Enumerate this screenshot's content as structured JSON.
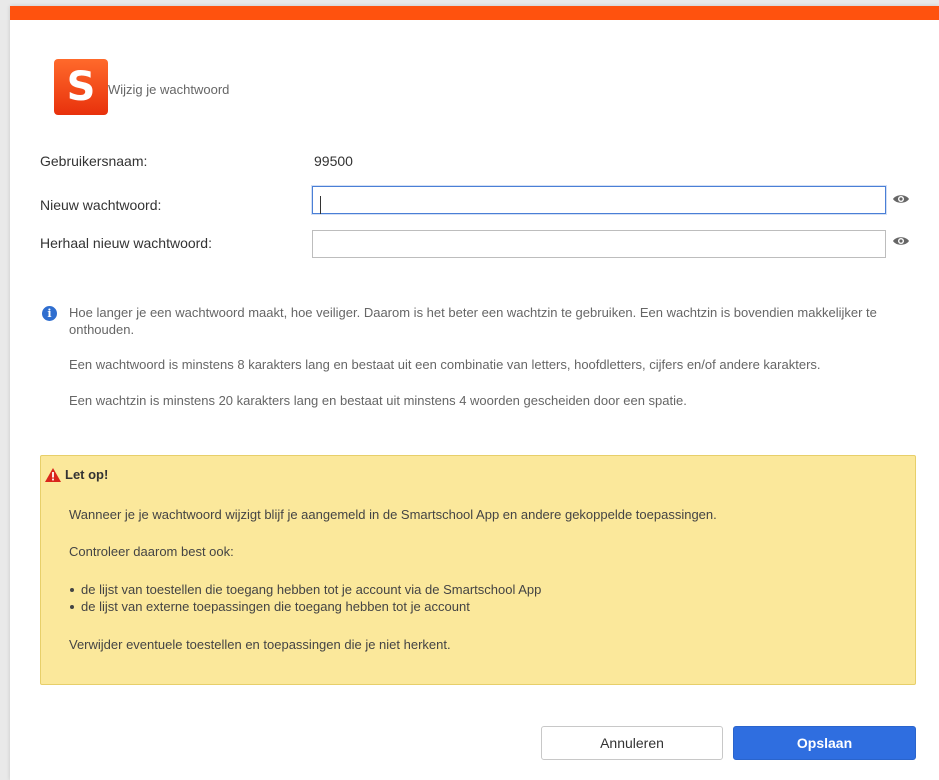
{
  "dialog": {
    "logo_letter": "S",
    "title": "Wijzig je wachtwoord",
    "accent_color": "#ff520e"
  },
  "form": {
    "username_label": "Gebruikersnaam:",
    "username_value": "99500",
    "new_password_label": "Nieuw wachtwoord:",
    "new_password_value": "",
    "repeat_password_label": "Herhaal nieuw wachtwoord:",
    "repeat_password_value": ""
  },
  "info": {
    "line1": "Hoe langer je een wachtwoord maakt, hoe veiliger. Daarom is het beter een wachtzin te gebruiken. Een wachtzin is bovendien makkelijker te onthouden.",
    "line2": "Een wachtwoord is minstens 8 karakters lang en bestaat uit een combinatie van letters, hoofdletters, cijfers en/of andere karakters.",
    "line3": "Een wachtzin is minstens 20 karakters lang en bestaat uit minstens 4 woorden gescheiden door een spatie."
  },
  "warning": {
    "title": "Let op!",
    "text1": "Wanneer je je wachtwoord wijzigt blijf je aangemeld in de Smartschool App en andere gekoppelde toepassingen.",
    "text2": "Controleer daarom best ook:",
    "items": [
      "de lijst van toestellen die toegang hebben tot je account via de Smartschool App",
      "de lijst van externe toepassingen die toegang hebben tot je account"
    ],
    "text3": "Verwijder eventuele toestellen en toepassingen die je niet herkent."
  },
  "buttons": {
    "cancel": "Annuleren",
    "save": "Opslaan"
  }
}
